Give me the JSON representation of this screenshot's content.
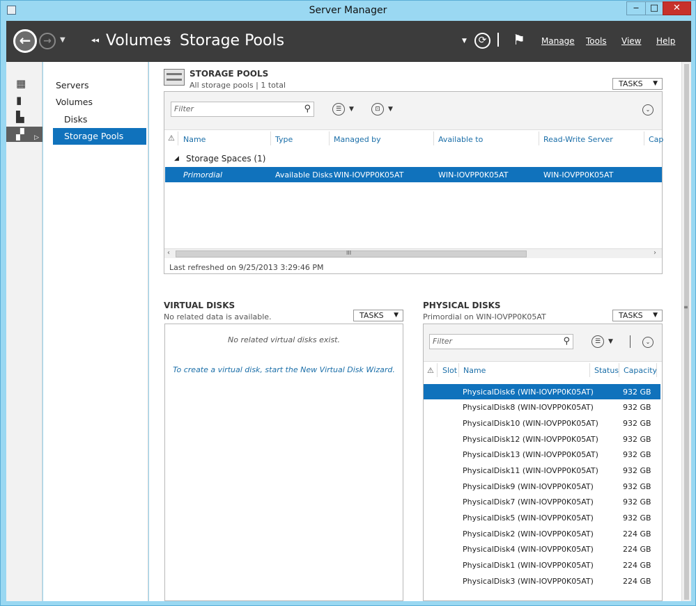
{
  "window": {
    "title": "Server Manager",
    "minimize": "‒",
    "maximize": "□",
    "close": "✕"
  },
  "header": {
    "back_glyph": "←",
    "forward_glyph": "→",
    "breadcrumb": [
      "Volumes",
      "Storage Pools"
    ],
    "menu": [
      "Manage",
      "Tools",
      "View",
      "Help"
    ]
  },
  "leftbar": {
    "icons": [
      "dashboard-icon",
      "local-server-icon",
      "all-servers-icon",
      "file-storage-icon"
    ],
    "selected_index": 3
  },
  "nav": {
    "items": [
      {
        "label": "Servers"
      },
      {
        "label": "Volumes"
      },
      {
        "label": "Disks"
      },
      {
        "label": "Storage Pools"
      }
    ]
  },
  "storage_pools": {
    "title": "STORAGE POOLS",
    "subtitle": "All storage pools | 1 total",
    "tasks": "TASKS",
    "filter_placeholder": "Filter",
    "columns": [
      "Name",
      "Type",
      "Managed by",
      "Available to",
      "Read-Write Server",
      "Cap"
    ],
    "group": "Storage Spaces (1)",
    "rows": [
      {
        "name": "Primordial",
        "type": "Available Disks",
        "managed_by": "WIN-IOVPP0K05AT",
        "available_to": "WIN-IOVPP0K05AT",
        "rw_server": "WIN-IOVPP0K05AT"
      }
    ],
    "scroll_grip": "III",
    "last_refreshed": "Last refreshed on 9/25/2013 3:29:46 PM"
  },
  "virtual_disks": {
    "title": "VIRTUAL DISKS",
    "subtitle": "No related data is available.",
    "tasks": "TASKS",
    "empty_message": "No related virtual disks exist.",
    "wizard_link": "To create a virtual disk, start the New Virtual Disk Wizard."
  },
  "physical_disks": {
    "title": "PHYSICAL DISKS",
    "subtitle": "Primordial on WIN-IOVPP0K05AT",
    "tasks": "TASKS",
    "filter_placeholder": "Filter",
    "columns": [
      "Slot",
      "Name",
      "Status",
      "Capacity"
    ],
    "rows": [
      {
        "name": "PhysicalDisk6 (WIN-IOVPP0K05AT)",
        "capacity": "932 GB"
      },
      {
        "name": "PhysicalDisk8 (WIN-IOVPP0K05AT)",
        "capacity": "932 GB"
      },
      {
        "name": "PhysicalDisk10 (WIN-IOVPP0K05AT)",
        "capacity": "932 GB"
      },
      {
        "name": "PhysicalDisk12 (WIN-IOVPP0K05AT)",
        "capacity": "932 GB"
      },
      {
        "name": "PhysicalDisk13 (WIN-IOVPP0K05AT)",
        "capacity": "932 GB"
      },
      {
        "name": "PhysicalDisk11 (WIN-IOVPP0K05AT)",
        "capacity": "932 GB"
      },
      {
        "name": "PhysicalDisk9 (WIN-IOVPP0K05AT)",
        "capacity": "932 GB"
      },
      {
        "name": "PhysicalDisk7 (WIN-IOVPP0K05AT)",
        "capacity": "932 GB"
      },
      {
        "name": "PhysicalDisk5 (WIN-IOVPP0K05AT)",
        "capacity": "932 GB"
      },
      {
        "name": "PhysicalDisk2 (WIN-IOVPP0K05AT)",
        "capacity": "224 GB"
      },
      {
        "name": "PhysicalDisk4 (WIN-IOVPP0K05AT)",
        "capacity": "224 GB"
      },
      {
        "name": "PhysicalDisk1 (WIN-IOVPP0K05AT)",
        "capacity": "224 GB"
      },
      {
        "name": "PhysicalDisk3 (WIN-IOVPP0K05AT)",
        "capacity": "224 GB"
      }
    ]
  },
  "colors": {
    "selection": "#1072bc",
    "header": "#3c3c3c",
    "frame": "#9ad8f2",
    "close": "#c7312b"
  }
}
